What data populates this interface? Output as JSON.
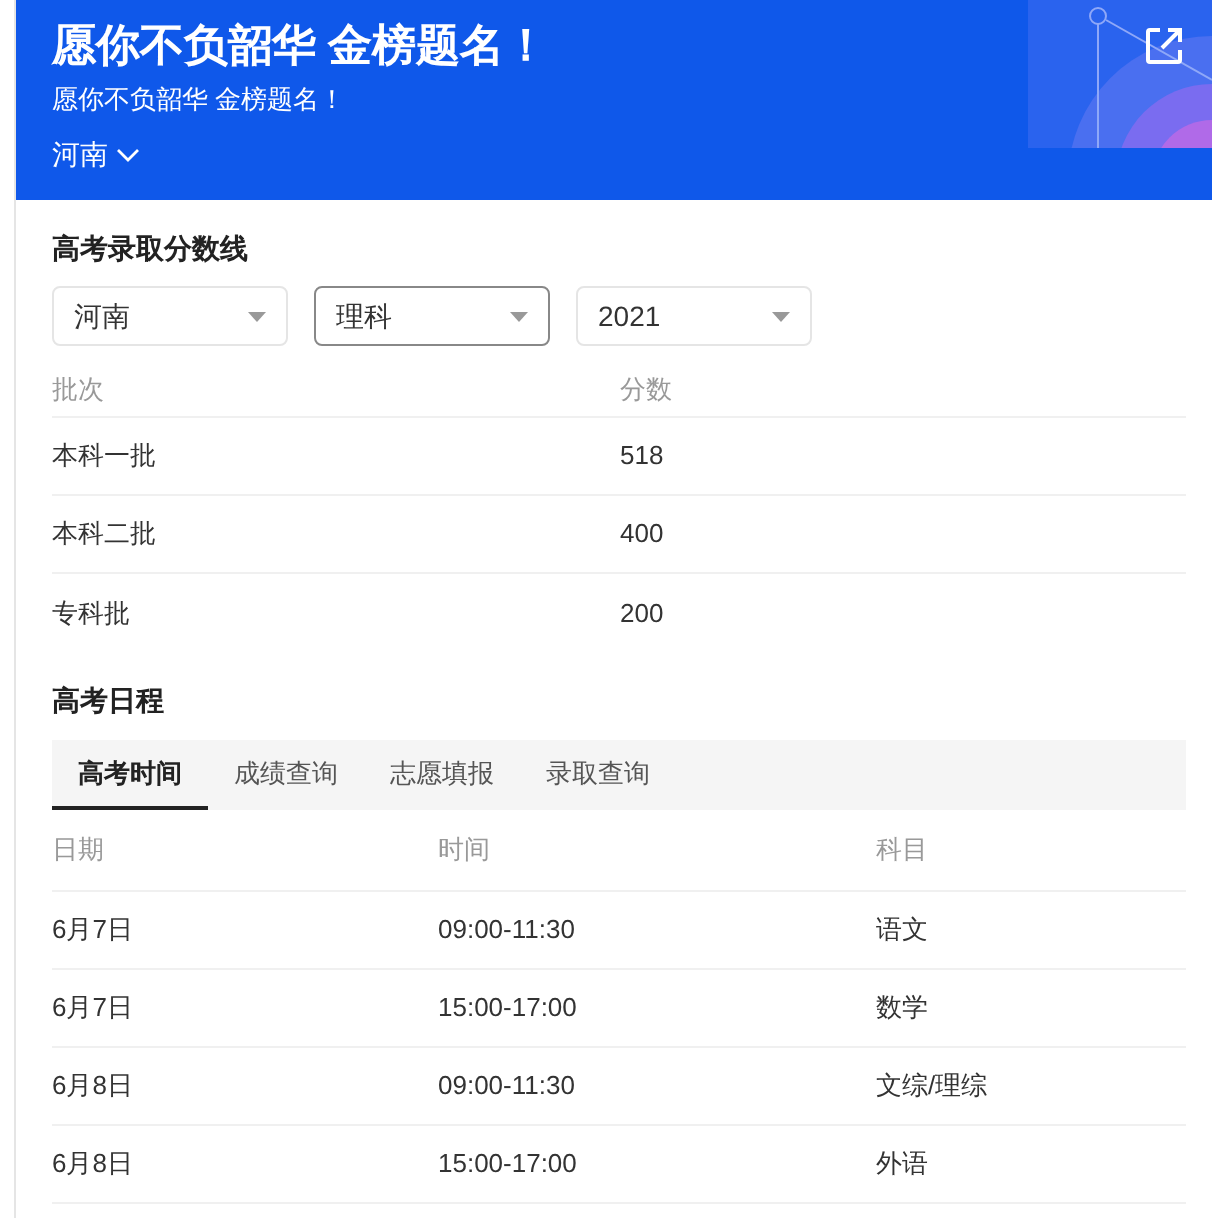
{
  "header": {
    "title": "愿你不负韶华 金榜题名！",
    "subtitle": "愿你不负韶华 金榜题名！",
    "region": "河南"
  },
  "scores": {
    "title": "高考录取分数线",
    "selects": [
      {
        "value": "河南",
        "focused": false
      },
      {
        "value": "理科",
        "focused": true
      },
      {
        "value": "2021",
        "focused": false
      }
    ],
    "columns": [
      "批次",
      "分数"
    ],
    "rows": [
      [
        "本科一批",
        "518"
      ],
      [
        "本科二批",
        "400"
      ],
      [
        "专科批",
        "200"
      ]
    ]
  },
  "schedule": {
    "title": "高考日程",
    "tabs": [
      {
        "label": "高考时间",
        "selected": true
      },
      {
        "label": "成绩查询",
        "selected": false
      },
      {
        "label": "志愿填报",
        "selected": false
      },
      {
        "label": "录取查询",
        "selected": false
      }
    ],
    "columns": [
      "日期",
      "时间",
      "科目"
    ],
    "rows": [
      [
        "6月7日",
        "09:00-11:30",
        "语文"
      ],
      [
        "6月7日",
        "15:00-17:00",
        "数学"
      ],
      [
        "6月8日",
        "09:00-11:30",
        "文综/理综"
      ],
      [
        "6月8日",
        "15:00-17:00",
        "外语"
      ]
    ]
  }
}
